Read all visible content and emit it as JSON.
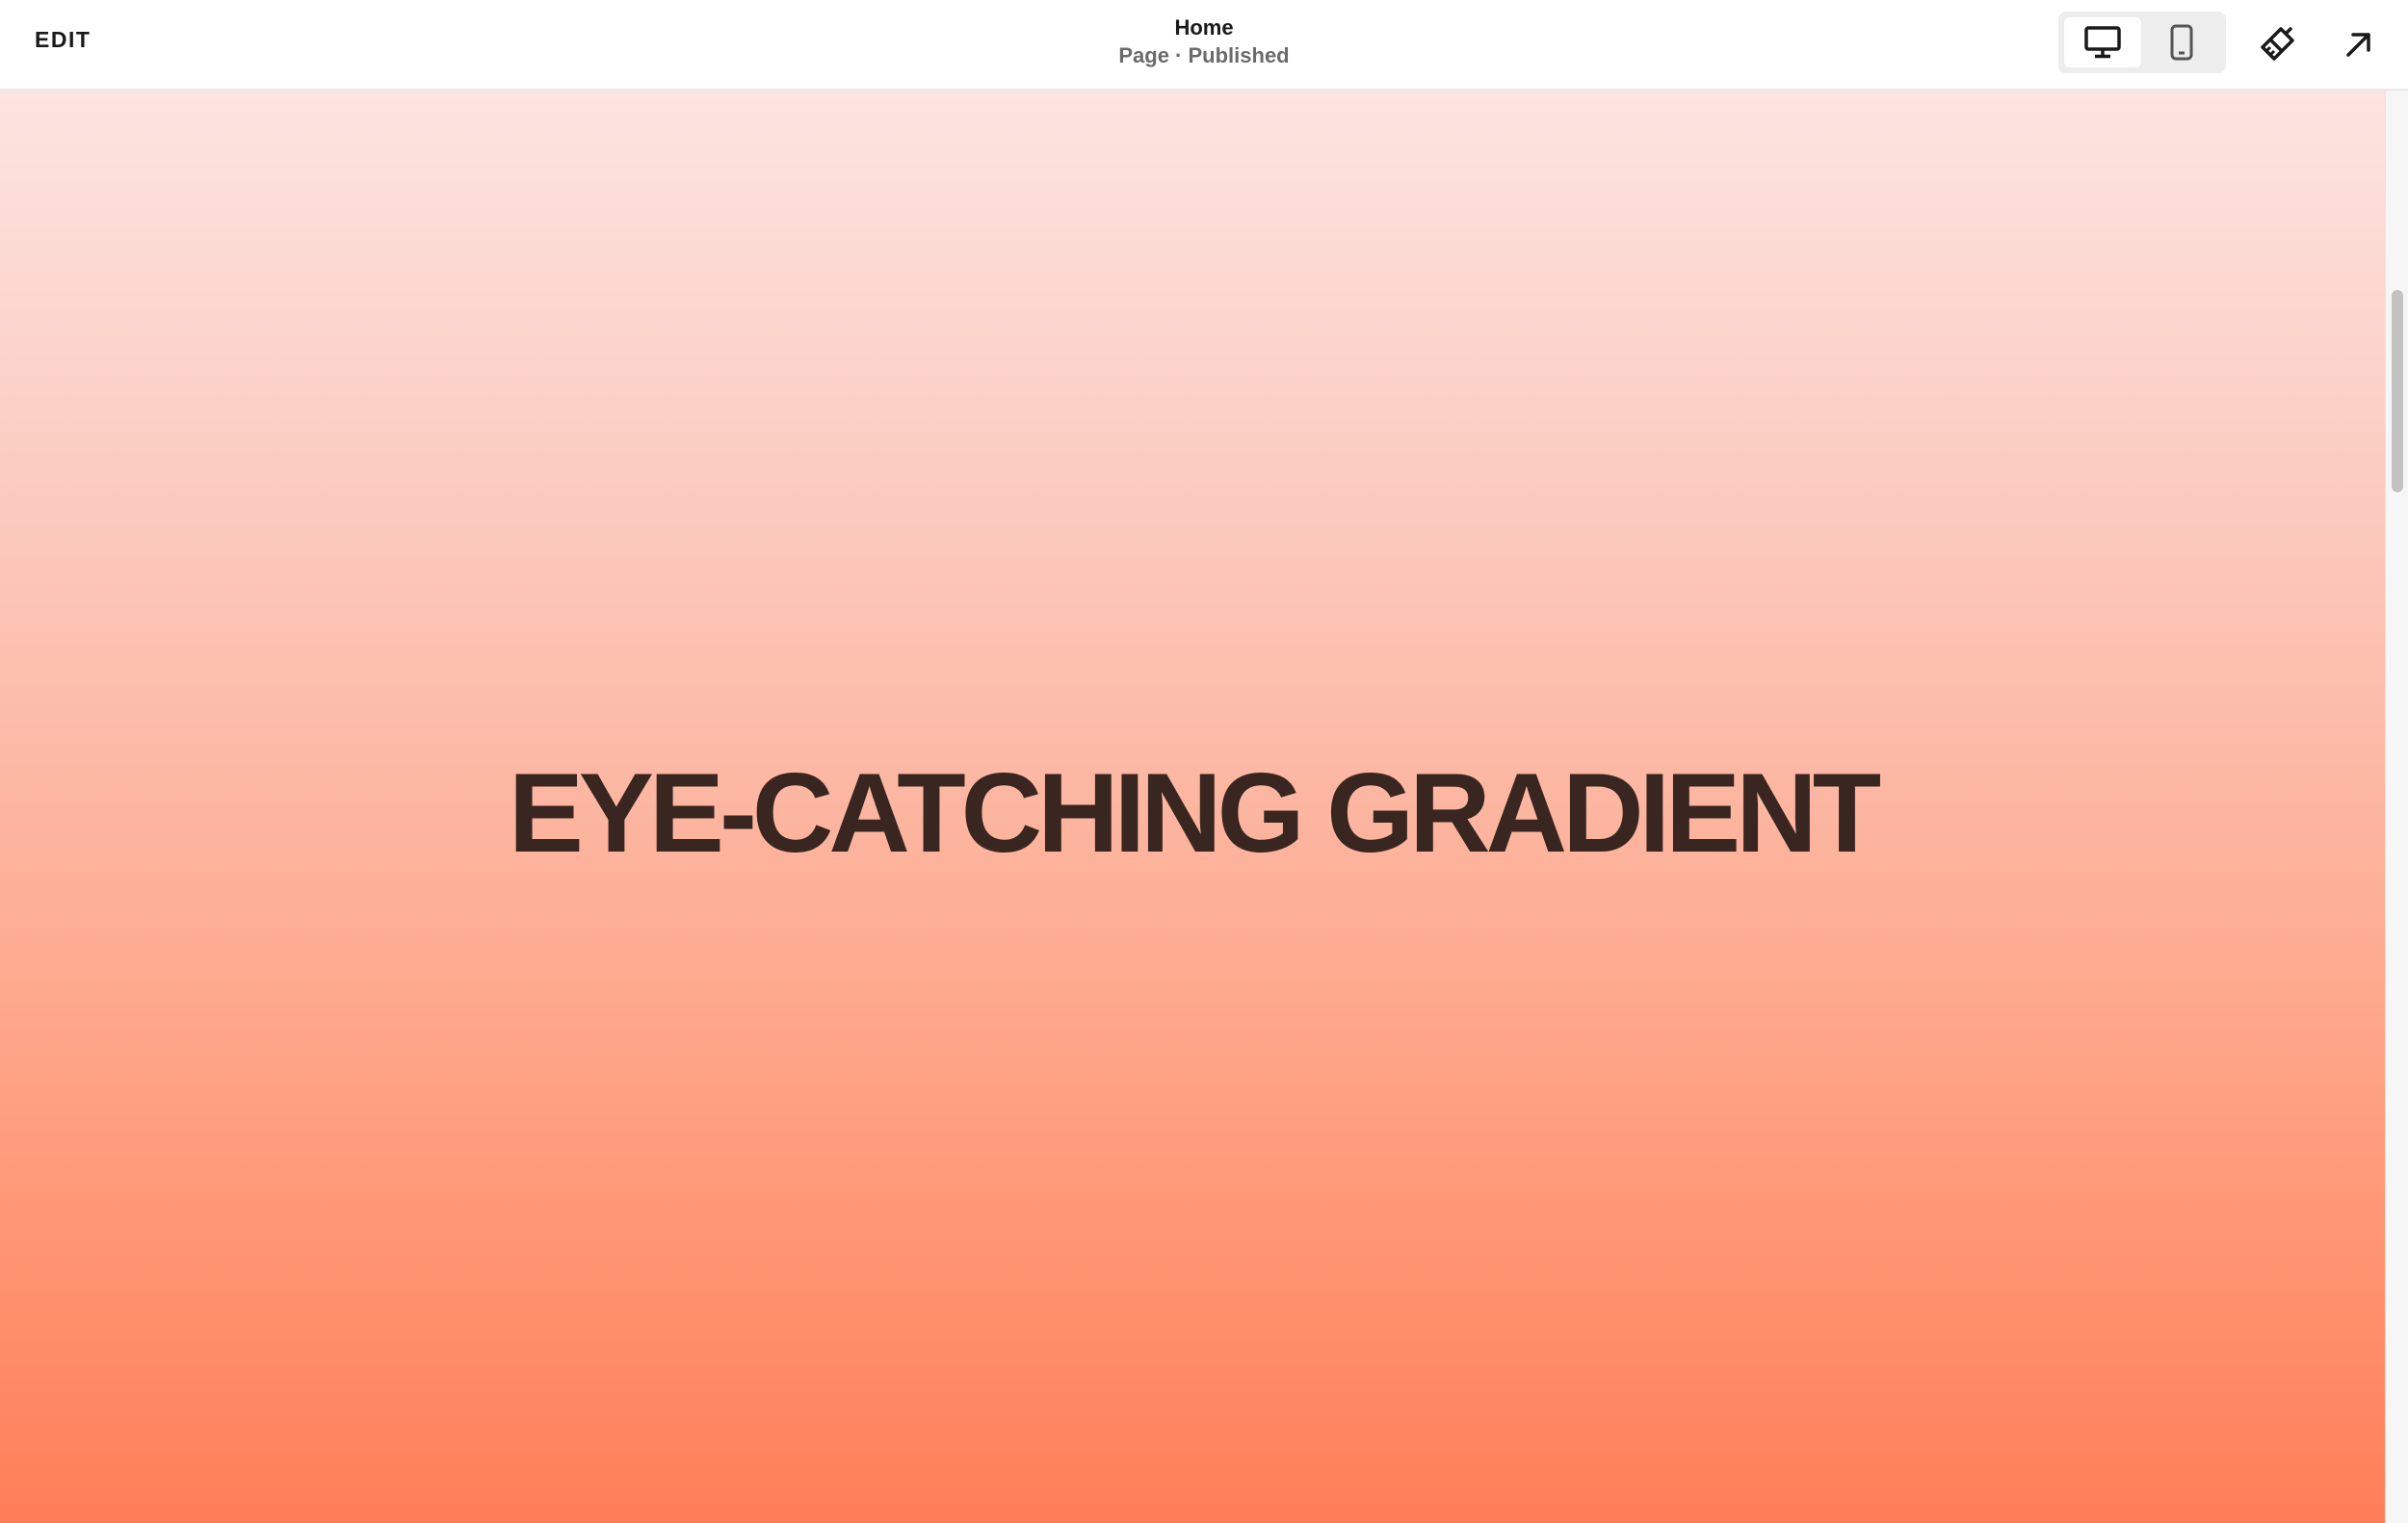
{
  "toolbar": {
    "edit_label": "EDIT",
    "page_name": "Home",
    "page_status": "Page · Published",
    "device_toggle": {
      "selected": "desktop",
      "options": [
        "desktop",
        "mobile"
      ]
    },
    "icons": {
      "desktop": "desktop-monitor-icon",
      "mobile": "mobile-phone-icon",
      "design": "paintbrush-icon",
      "exit": "arrow-up-right-icon"
    }
  },
  "canvas": {
    "hero_title": "EYE-CATCHING GRADIENT",
    "gradient_colors": [
      "#fce4e1",
      "#fbc9bd",
      "#fdae95",
      "#ff9573",
      "#ff7e58"
    ],
    "title_color": "#3a2620"
  }
}
